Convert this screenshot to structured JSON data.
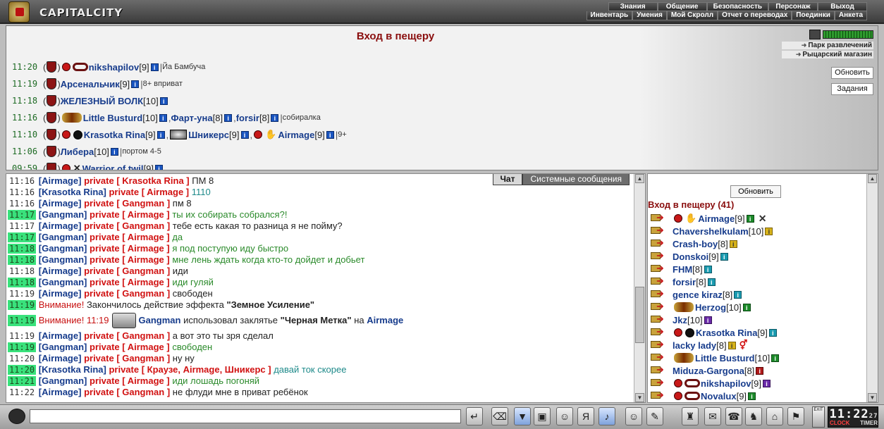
{
  "app": {
    "logo_text": "CAPITALCITY"
  },
  "nav": {
    "top": [
      "Знания",
      "Общение",
      "Безопасность",
      "Персонаж",
      "Выход"
    ],
    "sub": [
      "Инвентарь",
      "Умения",
      "Мой Скролл",
      "Отчет о переводах",
      "Поединки",
      "Анкета"
    ]
  },
  "room": {
    "title": "Вход в пещеру",
    "places": [
      "Парк развлечений",
      "Рыцарский магазин"
    ],
    "refresh_label": "Обновить",
    "quests_label": "Задания",
    "rows": [
      {
        "time": "11:20",
        "text": [
          {
            "t": "nick",
            "v": "nikshapilov"
          },
          {
            "t": "lvl",
            "v": "[9]"
          }
        ],
        "note": "Йа Бамбуча"
      },
      {
        "time": "11:19",
        "text": [
          {
            "t": "nick",
            "v": "Арсенальчик"
          },
          {
            "t": "lvl",
            "v": "[9]"
          }
        ],
        "note": "8+ вприват"
      },
      {
        "time": "11:18",
        "text": [
          {
            "t": "nick",
            "v": "ЖЕЛЕЗНЫЙ ВОЛК"
          },
          {
            "t": "lvl",
            "v": "[10]"
          }
        ],
        "note": ""
      },
      {
        "time": "11:16",
        "text": [
          {
            "t": "nick",
            "v": "Little Busturd"
          },
          {
            "t": "lvl",
            "v": "[10]"
          },
          {
            "t": "nick",
            "v": "Фарт-уна"
          },
          {
            "t": "lvl",
            "v": "[8]"
          },
          {
            "t": "nick",
            "v": "forsir"
          },
          {
            "t": "lvl",
            "v": "[8]"
          }
        ],
        "note": "собиралка"
      },
      {
        "time": "11:10",
        "text": [
          {
            "t": "nick",
            "v": "Krasotka Rina"
          },
          {
            "t": "lvl",
            "v": "[9]"
          },
          {
            "t": "nick",
            "v": "Шникерс"
          },
          {
            "t": "lvl",
            "v": "[9]"
          },
          {
            "t": "nick",
            "v": "Airmage"
          },
          {
            "t": "lvl",
            "v": "[9]"
          }
        ],
        "note": "9+"
      },
      {
        "time": "11:06",
        "text": [
          {
            "t": "nick",
            "v": "Либера"
          },
          {
            "t": "lvl",
            "v": "[10]"
          }
        ],
        "note": "портом 4-5"
      },
      {
        "time": "09:59",
        "text": [
          {
            "t": "nick",
            "v": "Warrior of twil"
          },
          {
            "t": "lvl",
            "v": "[9]"
          }
        ],
        "note": ""
      }
    ]
  },
  "chat": {
    "tabs": [
      "Чат",
      "Системные сообщения"
    ],
    "messages": [
      {
        "time": "11:16",
        "hl": false,
        "from": "Airmage",
        "to": "Krasotka Rina",
        "text": "ПМ 8",
        "color": "dark"
      },
      {
        "time": "11:16",
        "hl": false,
        "from": "Krasotka Rina",
        "to": "Airmage",
        "text": "1110",
        "color": "teal"
      },
      {
        "time": "11:16",
        "hl": false,
        "from": "Airmage",
        "to": "Gangman",
        "text": "пм 8",
        "color": "dark"
      },
      {
        "time": "11:17",
        "hl": true,
        "from": "Gangman",
        "to": "Airmage",
        "text": "ты их собирать собрался?!",
        "color": "green"
      },
      {
        "time": "11:17",
        "hl": false,
        "from": "Airmage",
        "to": "Gangman",
        "text": "тебе есть какая то разница я не пойму?",
        "color": "dark"
      },
      {
        "time": "11:17",
        "hl": true,
        "from": "Gangman",
        "to": "Airmage",
        "text": "да",
        "color": "green"
      },
      {
        "time": "11:18",
        "hl": true,
        "from": "Gangman",
        "to": "Airmage",
        "text": "я под поступую иду быстро",
        "color": "green"
      },
      {
        "time": "11:18",
        "hl": true,
        "from": "Gangman",
        "to": "Airmage",
        "text": "мне лень ждать когда кто-то дойдет и добьет",
        "color": "green"
      },
      {
        "time": "11:18",
        "hl": false,
        "from": "Airmage",
        "to": "Gangman",
        "text": "иди",
        "color": "dark"
      },
      {
        "time": "11:18",
        "hl": true,
        "from": "Gangman",
        "to": "Airmage",
        "text": "иди гуляй",
        "color": "green"
      },
      {
        "time": "11:19",
        "hl": false,
        "from": "Airmage",
        "to": "Gangman",
        "text": "свободен",
        "color": "dark"
      }
    ],
    "system1": {
      "time": "11:19",
      "attention": "Внимание!",
      "text": "Закончилось действие эффекта",
      "effect": "\"Земное Усиление\""
    },
    "system2": {
      "time": "11:19",
      "attention": "Внимание! 11:19",
      "who": "Gangman",
      "text": "использовал заклятье",
      "spell": "\"Черная Метка\"",
      "on": "на",
      "target": "Airmage"
    },
    "messages2": [
      {
        "time": "11:19",
        "hl": false,
        "from": "Airmage",
        "to": "Gangman",
        "text": "а вот это ты зря сделал",
        "color": "dark"
      },
      {
        "time": "11:19",
        "hl": true,
        "from": "Gangman",
        "to": "Airmage",
        "text": "свободен",
        "color": "green"
      },
      {
        "time": "11:20",
        "hl": false,
        "from": "Airmage",
        "to": "Gangman",
        "text": "ну ну",
        "color": "dark"
      },
      {
        "time": "11:20",
        "hl": true,
        "from": "Krasotka Rina",
        "to": "Краузе, Airmage, Шникерс",
        "text": "давай ток скорее",
        "color": "teal"
      },
      {
        "time": "11:21",
        "hl": true,
        "from": "Gangman",
        "to": "Airmage",
        "text": "иди лошадь погоняй",
        "color": "green"
      },
      {
        "time": "11:22",
        "hl": false,
        "from": "Airmage",
        "to": "Gangman",
        "text": "не флуди мне в приват ребёнок",
        "color": "dark"
      }
    ]
  },
  "online": {
    "refresh_label": "Обновить",
    "title": "Вход в пещеру (41)",
    "users": [
      {
        "name": "Airmage",
        "lvl": "[9]",
        "info": "green",
        "extra": "x"
      },
      {
        "name": "Chavershelkulam",
        "lvl": "[10]",
        "info": "yellow"
      },
      {
        "name": "Crash-boy",
        "lvl": "[8]",
        "info": "yellow"
      },
      {
        "name": "Donskoi",
        "lvl": "[9]",
        "info": "teal"
      },
      {
        "name": "FHM",
        "lvl": "[8]",
        "info": "teal"
      },
      {
        "name": "forsir",
        "lvl": "[8]",
        "info": "teal"
      },
      {
        "name": "gence kiraz",
        "lvl": "[8]",
        "info": "teal"
      },
      {
        "name": "Herzog",
        "lvl": "[10]",
        "info": "green"
      },
      {
        "name": "Jkz",
        "lvl": "[10]",
        "info": "purple"
      },
      {
        "name": "Krasotka Rina",
        "lvl": "[9]",
        "info": "teal"
      },
      {
        "name": "lacky lady",
        "lvl": "[8]",
        "info": "yellow",
        "extra": "pink"
      },
      {
        "name": "Little Busturd",
        "lvl": "[10]",
        "info": "green"
      },
      {
        "name": "Miduza-Gargona",
        "lvl": "[8]",
        "info": "red"
      },
      {
        "name": "nikshapilov",
        "lvl": "[9]",
        "info": "purple"
      },
      {
        "name": "Novalux",
        "lvl": "[9]",
        "info": "green"
      }
    ]
  },
  "clock": {
    "time": "11:22",
    "seconds": "27",
    "clock_label": "CLOCK",
    "timer_label": "TIMER"
  },
  "exit_label": "EXIT"
}
